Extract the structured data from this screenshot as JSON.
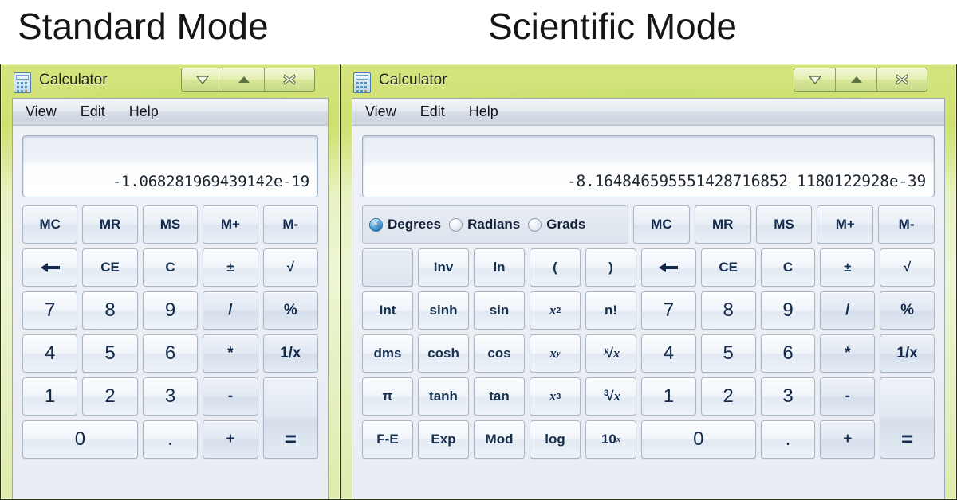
{
  "headings": {
    "standard": "Standard Mode",
    "scientific": "Scientific Mode"
  },
  "window": {
    "title": "Calculator",
    "icon": "calculator-icon",
    "controls": [
      {
        "name": "minimize",
        "glyph": "▽"
      },
      {
        "name": "maximize",
        "glyph": "▲"
      },
      {
        "name": "close",
        "glyph": "✕"
      }
    ],
    "menu": [
      "View",
      "Edit",
      "Help"
    ]
  },
  "standard": {
    "display_value": "-1.068281969439142e-19",
    "keys": [
      {
        "label": "MC",
        "type": "mem"
      },
      {
        "label": "MR",
        "type": "mem"
      },
      {
        "label": "MS",
        "type": "mem"
      },
      {
        "label": "M+",
        "type": "mem"
      },
      {
        "label": "M-",
        "type": "mem"
      },
      {
        "label": "←",
        "type": "fn"
      },
      {
        "label": "CE",
        "type": "fn"
      },
      {
        "label": "C",
        "type": "fn"
      },
      {
        "label": "±",
        "type": "fn"
      },
      {
        "label": "√",
        "type": "fn"
      },
      {
        "label": "7",
        "type": "num"
      },
      {
        "label": "8",
        "type": "num"
      },
      {
        "label": "9",
        "type": "num"
      },
      {
        "label": "/",
        "type": "op"
      },
      {
        "label": "%",
        "type": "op"
      },
      {
        "label": "4",
        "type": "num"
      },
      {
        "label": "5",
        "type": "num"
      },
      {
        "label": "6",
        "type": "num"
      },
      {
        "label": "*",
        "type": "op"
      },
      {
        "label": "1/x",
        "type": "op"
      },
      {
        "label": "1",
        "type": "num"
      },
      {
        "label": "2",
        "type": "num"
      },
      {
        "label": "3",
        "type": "num"
      },
      {
        "label": "-",
        "type": "op"
      },
      {
        "label": "=",
        "type": "eq"
      },
      {
        "label": "0",
        "type": "num0"
      },
      {
        "label": ".",
        "type": "num"
      },
      {
        "label": "+",
        "type": "op"
      }
    ]
  },
  "scientific": {
    "display_value": "-8.164846595551428716852 1180122928e-39",
    "angle_modes": [
      {
        "label": "Degrees",
        "selected": true
      },
      {
        "label": "Radians",
        "selected": false
      },
      {
        "label": "Grads",
        "selected": false
      }
    ],
    "function_keys": [
      {
        "label": "",
        "type": "blank"
      },
      {
        "label": "Inv",
        "type": "fn"
      },
      {
        "label": "ln",
        "type": "fn"
      },
      {
        "label": "(",
        "type": "fn"
      },
      {
        "label": ")",
        "type": "fn"
      },
      {
        "label": "Int",
        "type": "fn"
      },
      {
        "label": "sinh",
        "type": "fn"
      },
      {
        "label": "sin",
        "type": "fn"
      },
      {
        "label": "x2",
        "type": "sup2"
      },
      {
        "label": "n!",
        "type": "fn"
      },
      {
        "label": "dms",
        "type": "fn"
      },
      {
        "label": "cosh",
        "type": "fn"
      },
      {
        "label": "cos",
        "type": "fn"
      },
      {
        "label": "xy",
        "type": "supy"
      },
      {
        "label": "y√x",
        "type": "rooty"
      },
      {
        "label": "π",
        "type": "fn"
      },
      {
        "label": "tanh",
        "type": "fn"
      },
      {
        "label": "tan",
        "type": "fn"
      },
      {
        "label": "x3",
        "type": "sup3"
      },
      {
        "label": "3√x",
        "type": "root3"
      },
      {
        "label": "F-E",
        "type": "fn"
      },
      {
        "label": "Exp",
        "type": "fn"
      },
      {
        "label": "Mod",
        "type": "fn"
      },
      {
        "label": "log",
        "type": "fn"
      },
      {
        "label": "10x",
        "type": "tenx"
      }
    ],
    "keys": [
      {
        "label": "MC",
        "type": "mem"
      },
      {
        "label": "MR",
        "type": "mem"
      },
      {
        "label": "MS",
        "type": "mem"
      },
      {
        "label": "M+",
        "type": "mem"
      },
      {
        "label": "M-",
        "type": "mem"
      },
      {
        "label": "←",
        "type": "fn"
      },
      {
        "label": "CE",
        "type": "fn"
      },
      {
        "label": "C",
        "type": "fn"
      },
      {
        "label": "±",
        "type": "fn"
      },
      {
        "label": "√",
        "type": "fn"
      },
      {
        "label": "7",
        "type": "num"
      },
      {
        "label": "8",
        "type": "num"
      },
      {
        "label": "9",
        "type": "num"
      },
      {
        "label": "/",
        "type": "op"
      },
      {
        "label": "%",
        "type": "op"
      },
      {
        "label": "4",
        "type": "num"
      },
      {
        "label": "5",
        "type": "num"
      },
      {
        "label": "6",
        "type": "num"
      },
      {
        "label": "*",
        "type": "op"
      },
      {
        "label": "1/x",
        "type": "op"
      },
      {
        "label": "1",
        "type": "num"
      },
      {
        "label": "2",
        "type": "num"
      },
      {
        "label": "3",
        "type": "num"
      },
      {
        "label": "-",
        "type": "op"
      },
      {
        "label": "=",
        "type": "eq"
      },
      {
        "label": "0",
        "type": "num0"
      },
      {
        "label": ".",
        "type": "num"
      },
      {
        "label": "+",
        "type": "op"
      }
    ]
  },
  "colors": {
    "frame_green": "#cde06f",
    "client_bg": "#eef1f6",
    "key_text": "#122a4e",
    "radio_selected": "#12568f"
  }
}
